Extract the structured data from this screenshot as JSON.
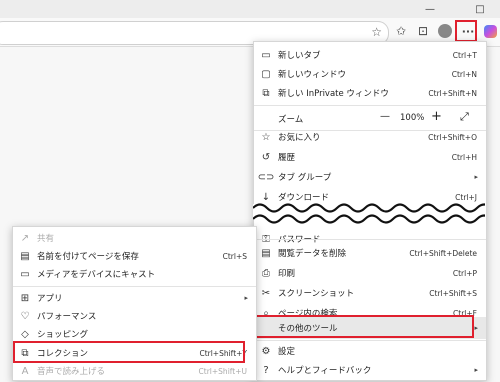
{
  "titlebar": {
    "minimize": "—",
    "maximize": "□"
  },
  "toolbar": {
    "more_icon": "···"
  },
  "main_menu": {
    "items": [
      {
        "label": "新しいタブ",
        "shortcut": "Ctrl+T"
      },
      {
        "label": "新しいウィンドウ",
        "shortcut": "Ctrl+N"
      },
      {
        "label": "新しい InPrivate ウィンドウ",
        "shortcut": "Ctrl+Shift+N"
      }
    ],
    "zoom": {
      "label": "ズーム",
      "minus": "—",
      "value": "100%",
      "plus": "+"
    },
    "items2": [
      {
        "label": "お気に入り",
        "shortcut": "Ctrl+Shift+O"
      },
      {
        "label": "履歴",
        "shortcut": "Ctrl+H"
      },
      {
        "label": "タブ グループ",
        "shortcut": ""
      },
      {
        "label": "ダウンロード",
        "shortcut": "Ctrl+J"
      }
    ],
    "password": "パスワード",
    "items3": [
      {
        "label": "閲覧データを削除",
        "shortcut": "Ctrl+Shift+Delete"
      },
      {
        "label": "印刷",
        "shortcut": "Ctrl+P"
      },
      {
        "label": "スクリーンショット",
        "shortcut": "Ctrl+Shift+S"
      },
      {
        "label": "ページ内の検索",
        "shortcut": "Ctrl+F"
      }
    ],
    "other_tools": "その他のツール",
    "settings": "設定",
    "help": "ヘルプとフィードバック"
  },
  "sub_menu": {
    "share": "共有",
    "save_as": {
      "label": "名前を付けてページを保存",
      "shortcut": "Ctrl+S"
    },
    "cast": "メディアをデバイスにキャスト",
    "apps": "アプリ",
    "performance": "パフォーマンス",
    "shopping": "ショッピング",
    "collections": {
      "label": "コレクション",
      "shortcut": "Ctrl+Shift+Y"
    },
    "read_aloud": {
      "label": "音声で読み上げる",
      "shortcut": "Ctrl+Shift+U"
    }
  },
  "colors": {
    "highlight": "#e0202e"
  }
}
